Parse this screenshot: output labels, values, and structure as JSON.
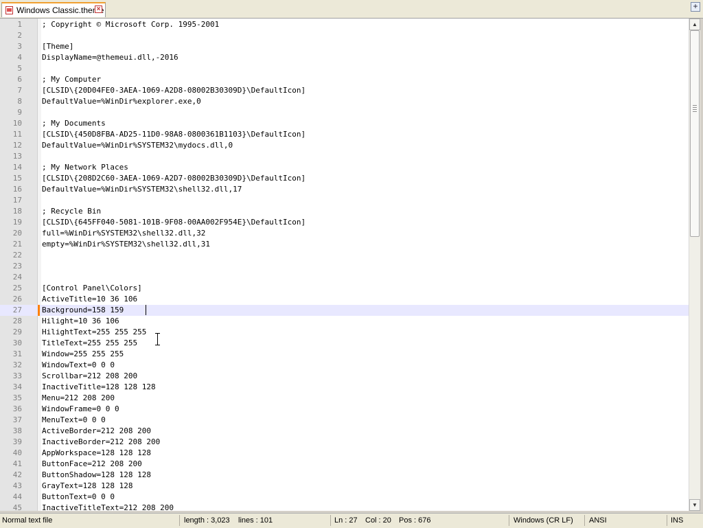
{
  "tab": {
    "title": "Windows Classic.theme",
    "close_glyph": "×",
    "new_tab_glyph": "+",
    "icon": "document-icon"
  },
  "editor": {
    "current_line": 27,
    "lines": [
      {
        "n": "1",
        "t": "; Copyright © Microsoft Corp. 1995-2001"
      },
      {
        "n": "2",
        "t": ""
      },
      {
        "n": "3",
        "t": "[Theme]"
      },
      {
        "n": "4",
        "t": "DisplayName=@themeui.dll,-2016"
      },
      {
        "n": "5",
        "t": ""
      },
      {
        "n": "6",
        "t": "; My Computer"
      },
      {
        "n": "7",
        "t": "[CLSID\\{20D04FE0-3AEA-1069-A2D8-08002B30309D}\\DefaultIcon]"
      },
      {
        "n": "8",
        "t": "DefaultValue=%WinDir%explorer.exe,0"
      },
      {
        "n": "9",
        "t": ""
      },
      {
        "n": "10",
        "t": "; My Documents"
      },
      {
        "n": "11",
        "t": "[CLSID\\{450D8FBA-AD25-11D0-98A8-0800361B1103}\\DefaultIcon]"
      },
      {
        "n": "12",
        "t": "DefaultValue=%WinDir%SYSTEM32\\mydocs.dll,0"
      },
      {
        "n": "13",
        "t": ""
      },
      {
        "n": "14",
        "t": "; My Network Places"
      },
      {
        "n": "15",
        "t": "[CLSID\\{208D2C60-3AEA-1069-A2D7-08002B30309D}\\DefaultIcon]"
      },
      {
        "n": "16",
        "t": "DefaultValue=%WinDir%SYSTEM32\\shell32.dll,17"
      },
      {
        "n": "17",
        "t": ""
      },
      {
        "n": "18",
        "t": "; Recycle Bin"
      },
      {
        "n": "19",
        "t": "[CLSID\\{645FF040-5081-101B-9F08-00AA002F954E}\\DefaultIcon]"
      },
      {
        "n": "20",
        "t": "full=%WinDir%SYSTEM32\\shell32.dll,32"
      },
      {
        "n": "21",
        "t": "empty=%WinDir%SYSTEM32\\shell32.dll,31"
      },
      {
        "n": "22",
        "t": ""
      },
      {
        "n": "23",
        "t": ""
      },
      {
        "n": "24",
        "t": ""
      },
      {
        "n": "25",
        "t": "[Control Panel\\Colors]"
      },
      {
        "n": "26",
        "t": "ActiveTitle=10 36 106"
      },
      {
        "n": "27",
        "t": "Background=158 159 "
      },
      {
        "n": "28",
        "t": "Hilight=10 36 106"
      },
      {
        "n": "29",
        "t": "HilightText=255 255 255"
      },
      {
        "n": "30",
        "t": "TitleText=255 255 255"
      },
      {
        "n": "31",
        "t": "Window=255 255 255"
      },
      {
        "n": "32",
        "t": "WindowText=0 0 0"
      },
      {
        "n": "33",
        "t": "Scrollbar=212 208 200"
      },
      {
        "n": "34",
        "t": "InactiveTitle=128 128 128"
      },
      {
        "n": "35",
        "t": "Menu=212 208 200"
      },
      {
        "n": "36",
        "t": "WindowFrame=0 0 0"
      },
      {
        "n": "37",
        "t": "MenuText=0 0 0"
      },
      {
        "n": "38",
        "t": "ActiveBorder=212 208 200"
      },
      {
        "n": "39",
        "t": "InactiveBorder=212 208 200"
      },
      {
        "n": "40",
        "t": "AppWorkspace=128 128 128"
      },
      {
        "n": "41",
        "t": "ButtonFace=212 208 200"
      },
      {
        "n": "42",
        "t": "ButtonShadow=128 128 128"
      },
      {
        "n": "43",
        "t": "GrayText=128 128 128"
      },
      {
        "n": "44",
        "t": "ButtonText=0 0 0"
      },
      {
        "n": "45",
        "t": "InactiveTitleText=212 208 200"
      }
    ]
  },
  "scrollbar": {
    "up_glyph": "▲",
    "down_glyph": "▼",
    "position_fraction": 0.0,
    "visible_fraction": 0.44
  },
  "status": {
    "file_type": "Normal text file",
    "length": "length : 3,023",
    "lines": "lines : 101",
    "ln": "Ln : 27",
    "col": "Col : 20",
    "pos": "Pos : 676",
    "eol": "Windows (CR LF)",
    "encoding": "ANSI",
    "mode": "INS"
  },
  "colors": {
    "current_line_bg": "#e8e8ff",
    "current_line_marker": "#ff8000",
    "gutter_bg": "#e4e4e4",
    "tab_accent": "#f0a030"
  }
}
